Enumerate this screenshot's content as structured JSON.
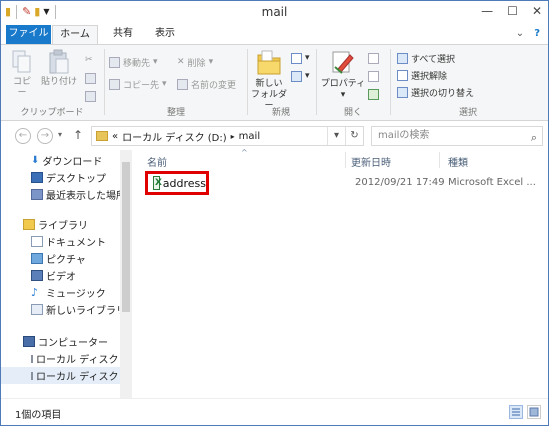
{
  "window": {
    "title": "mail"
  },
  "qat": {
    "icons": [
      "folder-icon",
      "properties-icon",
      "new-folder-icon",
      "dropdown-icon"
    ]
  },
  "ribbon": {
    "tabs": [
      "ファイル",
      "ホーム",
      "共有",
      "表示"
    ],
    "help": "?",
    "clipboard": {
      "copy": "コピー",
      "paste": "貼り付け",
      "label": "クリップボード"
    },
    "organize": {
      "move_to": "移動先",
      "copy_to": "コピー先",
      "delete": "削除",
      "rename": "名前の変更",
      "label": "整理"
    },
    "new": {
      "new_folder_line1": "新しい",
      "new_folder_line2": "フォルダー",
      "label": "新規"
    },
    "open": {
      "properties": "プロパティ",
      "label": "開く"
    },
    "select": {
      "select_all": "すべて選択",
      "select_none": "選択解除",
      "invert": "選択の切り替え",
      "label": "選択"
    }
  },
  "address": {
    "chevron": "«",
    "segments": [
      "ローカル ディスク (D:)",
      "mail"
    ],
    "separator": "▸",
    "search_placeholder": "mailの検索"
  },
  "nav": {
    "items": [
      {
        "label": "ダウンロード",
        "icon": "download-icon"
      },
      {
        "label": "デスクトップ",
        "icon": "desktop-icon"
      },
      {
        "label": "最近表示した場所",
        "icon": "recent-places-icon"
      },
      {
        "label": "ライブラリ",
        "icon": "libraries-icon"
      },
      {
        "label": "ドキュメント",
        "icon": "documents-icon"
      },
      {
        "label": "ピクチャ",
        "icon": "pictures-icon"
      },
      {
        "label": "ビデオ",
        "icon": "videos-icon"
      },
      {
        "label": "ミュージック",
        "icon": "music-icon"
      },
      {
        "label": "新しいライブラリ",
        "icon": "new-library-icon"
      },
      {
        "label": "コンピューター",
        "icon": "computer-icon"
      },
      {
        "label": "ローカル ディスク (C",
        "icon": "drive-icon"
      },
      {
        "label": "ローカル ディスク (D",
        "icon": "drive-icon"
      }
    ]
  },
  "columns": {
    "name": "名前",
    "date": "更新日時",
    "type": "種類"
  },
  "files": [
    {
      "name": "address",
      "date": "2012/09/21 17:49",
      "type": "Microsoft Excel ..."
    }
  ],
  "status": {
    "count": "1個の項目"
  },
  "colors": {
    "file_tab": "#1979ca",
    "highlight_box": "#e00000",
    "selected_nav": "#e5eef8"
  }
}
